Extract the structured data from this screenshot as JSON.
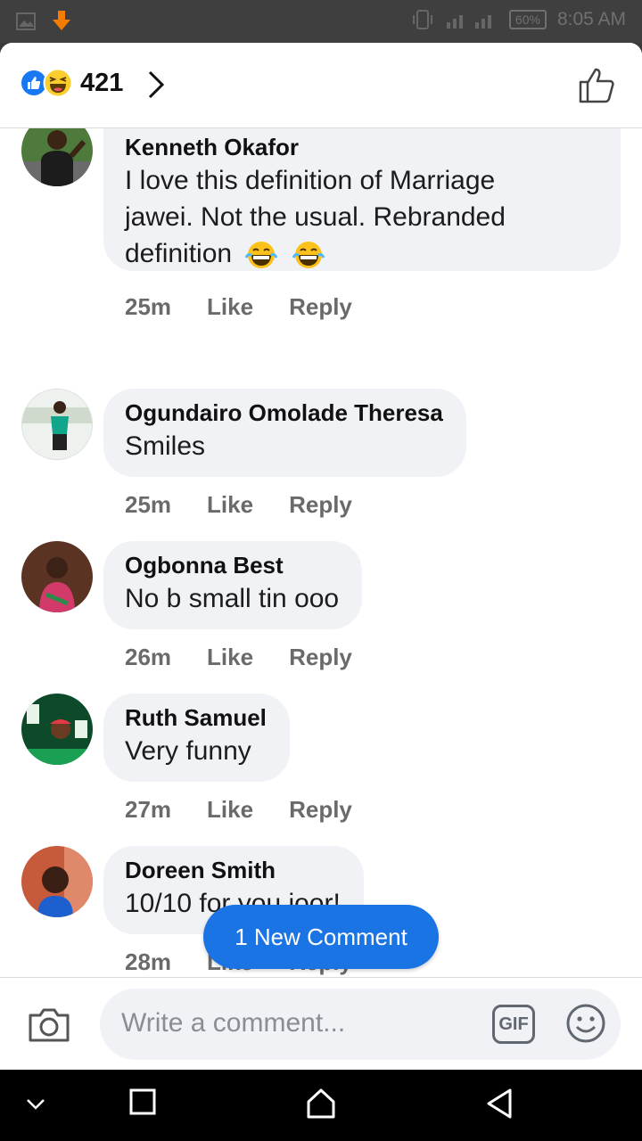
{
  "status_bar": {
    "time": "8:05 AM",
    "battery": "60%"
  },
  "header": {
    "reaction_count": "421"
  },
  "comments": [
    {
      "name": "Kenneth Okafor",
      "lines": [
        "I love this definition of Marriage",
        "jawei. Not the usual. Rebranded",
        "definition"
      ],
      "time": "25m",
      "like": "Like",
      "reply": "Reply"
    },
    {
      "name": "Ogundairo Omolade Theresa",
      "lines": [
        "Smiles"
      ],
      "time": "25m",
      "like": "Like",
      "reply": "Reply"
    },
    {
      "name": "Ogbonna Best",
      "lines": [
        "No b small tin ooo"
      ],
      "time": "26m",
      "like": "Like",
      "reply": "Reply"
    },
    {
      "name": "Ruth Samuel",
      "lines": [
        "Very funny"
      ],
      "time": "27m",
      "like": "Like",
      "reply": "Reply"
    },
    {
      "name": "Doreen Smith",
      "lines": [
        "10/10 for you joor!"
      ],
      "time": "28m",
      "like": "Like",
      "reply": "Reply"
    }
  ],
  "new_comment_button": "1 New Comment",
  "composer": {
    "placeholder": "Write a comment...",
    "gif_label": "GIF"
  }
}
